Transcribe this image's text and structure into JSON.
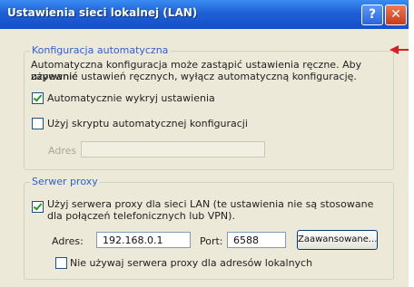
{
  "window": {
    "title": "Ustawienia sieci lokalnej (LAN)",
    "help_label": "?",
    "close_label": "✕"
  },
  "auto_config": {
    "group_title": "Konfiguracja automatyczna",
    "description_line1": "Automatyczna konfiguracja może zastąpić ustawienia ręczne. Aby zapewnić",
    "description_line2": "używanie ustawień ręcznych, wyłącz automatyczną konfigurację.",
    "auto_detect_label": "Automatycznie wykryj ustawienia",
    "auto_detect_checked": true,
    "script_label": "Użyj skryptu automatycznej konfiguracji",
    "script_checked": false,
    "address_label": "Adres",
    "address_value": ""
  },
  "proxy": {
    "group_title": "Serwer proxy",
    "use_proxy_line1": "Użyj serwera proxy dla sieci LAN (te ustawienia nie są stosowane",
    "use_proxy_line2": "dla połączeń telefonicznych lub VPN).",
    "use_proxy_checked": true,
    "address_label": "Adres:",
    "address_value": "192.168.0.1",
    "port_label": "Port:",
    "port_value": "6588",
    "advanced_label": "Zaawansowane...",
    "bypass_local_label": "Nie używaj serwera proxy dla adresów lokalnych",
    "bypass_local_checked": false
  },
  "colors": {
    "title_bar": "#1f5fd6",
    "group_title": "#2f5fcf",
    "annotation_arrow": "#d81f26"
  }
}
